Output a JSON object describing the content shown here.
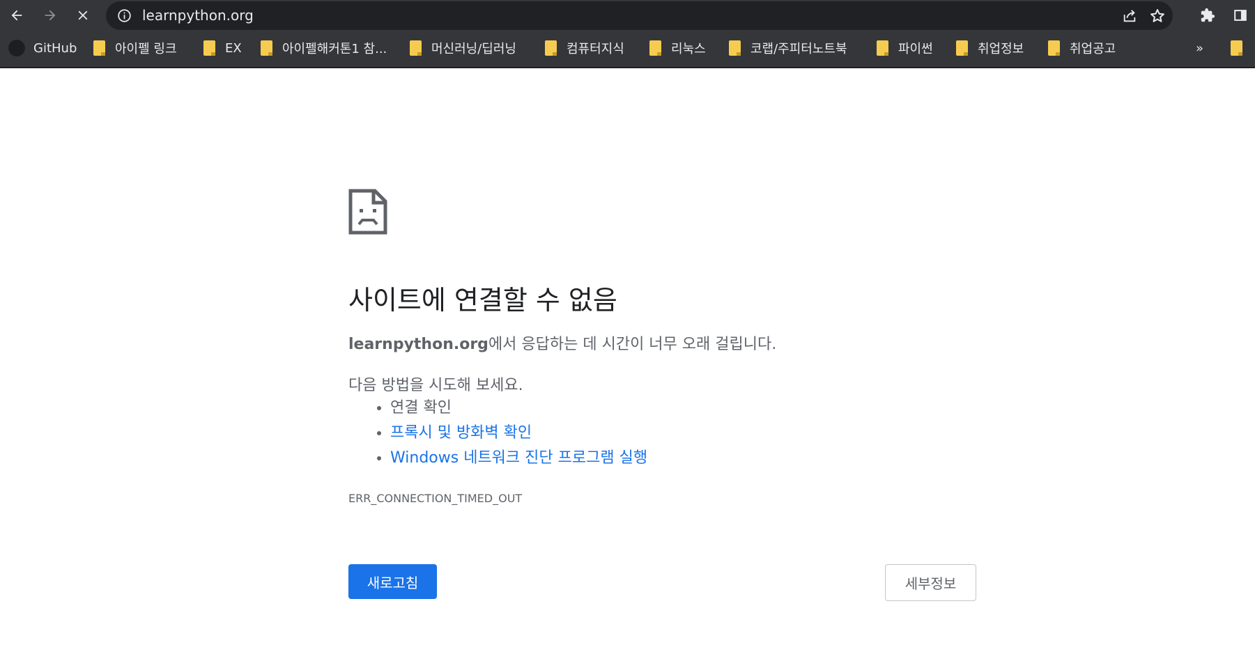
{
  "browser": {
    "url": "learnpython.org",
    "icons": {
      "back": "arrow-left-icon",
      "forward": "arrow-right-icon",
      "stop": "close-icon",
      "site_info": "info-icon",
      "share": "share-icon",
      "bookmark_star": "star-icon",
      "extensions": "puzzle-icon",
      "side_panel": "side-panel-icon"
    },
    "colors": {
      "toolbar": "#35363a",
      "omnibox": "#202124",
      "folder": "#f6cc50"
    }
  },
  "bookmarks": {
    "items": [
      {
        "label": "GitHub",
        "icon": "github-icon"
      },
      {
        "label": "아이펠 링크",
        "icon": "folder-icon"
      },
      {
        "label": "EX",
        "icon": "folder-icon"
      },
      {
        "label": "아이펠해커톤1 참...",
        "icon": "folder-icon"
      },
      {
        "label": "머신러닝/딥러닝",
        "icon": "folder-icon"
      },
      {
        "label": "컴퓨터지식",
        "icon": "folder-icon"
      },
      {
        "label": "리눅스",
        "icon": "folder-icon"
      },
      {
        "label": "코랩/주피터노트북",
        "icon": "folder-icon"
      },
      {
        "label": "파이썬",
        "icon": "folder-icon"
      },
      {
        "label": "취업정보",
        "icon": "folder-icon"
      },
      {
        "label": "취업공고",
        "icon": "folder-icon"
      }
    ],
    "overflow": "»"
  },
  "error": {
    "icon": "sad-page-icon",
    "title": "사이트에 연결할 수 없음",
    "host": "learnpython.org",
    "description_suffix": "에서 응답하는 데 시간이 너무 오래 걸립니다.",
    "try_label": "다음 방법을 시도해 보세요.",
    "suggestions": [
      {
        "text": "연결 확인",
        "link": false
      },
      {
        "text": "프록시 및 방화벽 확인",
        "link": true
      },
      {
        "text": "Windows 네트워크 진단 프로그램 실행",
        "link": true
      }
    ],
    "code": "ERR_CONNECTION_TIMED_OUT",
    "reload_label": "새로고침",
    "details_label": "세부정보",
    "colors": {
      "primary": "#1a73e8",
      "text": "#5f6368",
      "title": "#202124"
    }
  }
}
